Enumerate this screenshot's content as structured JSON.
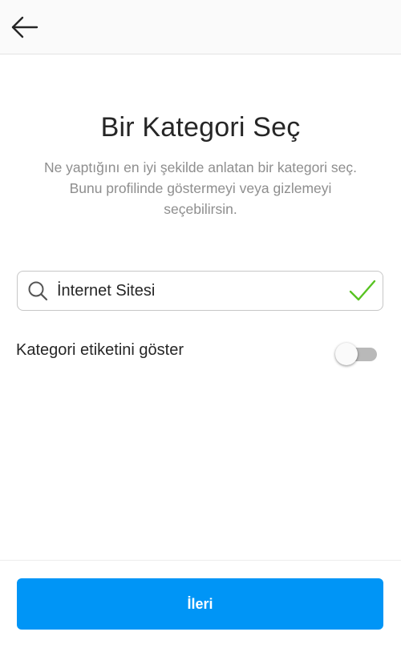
{
  "header": {
    "back_icon": "arrow-left-icon"
  },
  "main": {
    "title": "Bir Kategori Seç",
    "subtitle": "Ne yaptığını en iyi şekilde anlatan bir kategori seç. Bunu profilinde göstermeyi veya gizlemeyi seçebilirsin."
  },
  "search": {
    "icon": "search-icon",
    "value": "İnternet Sitesi",
    "status_icon": "check-icon",
    "status_color": "#58c322"
  },
  "toggle": {
    "label": "Kategori etiketini göster",
    "checked": false
  },
  "footer": {
    "next_label": "İleri",
    "button_color": "#0095f6"
  }
}
